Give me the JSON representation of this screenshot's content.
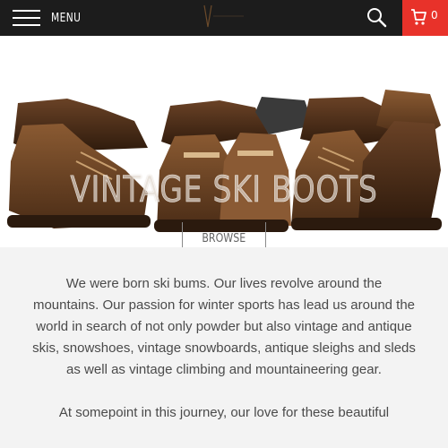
{
  "header": {
    "menu_label": "MENU",
    "cart_count": "0",
    "colors": {
      "bar": "#1c1c1c",
      "cart": "#e8322a"
    }
  },
  "icons": {
    "menu": "hamburger-icon",
    "search": "search-icon",
    "cart": "cart-icon",
    "logo": "brand-logo"
  },
  "hero": {
    "title": "VINTAGE SKI BOOTS",
    "browse_label": "BROWSE"
  },
  "content": {
    "paragraphs": [
      "We were born ski bums.  Our lives revolve around the mountains.  Our passion for winter sports has lead us around the world in search of not only powder but also vintage and antique skis, snowshoes, vintage snowboards, antique sleighs and sleds as well as vintage climbing and mountaineering gear.",
      "At somepoint in this journey, our love for these beautiful"
    ]
  }
}
